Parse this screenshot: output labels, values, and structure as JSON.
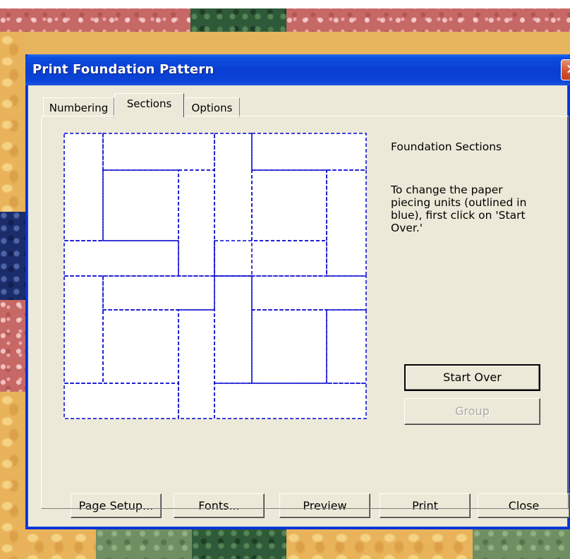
{
  "window": {
    "title": "Print Foundation Pattern",
    "close_glyph": "✕"
  },
  "tabs": [
    {
      "label": "Numbering",
      "active": false
    },
    {
      "label": "Sections",
      "active": true
    },
    {
      "label": "Options",
      "active": false
    }
  ],
  "sections_panel": {
    "heading": "Foundation Sections",
    "instructions": "To change the paper piecing units (outlined in blue), first click on 'Start Over.'",
    "start_over_label": "Start Over",
    "group_label": "Group",
    "group_enabled": false,
    "outline_color": "#0000cc"
  },
  "footer_buttons": {
    "page_setup": "Page Setup...",
    "fonts": "Fonts...",
    "preview": "Preview",
    "print": "Print",
    "close": "Close"
  },
  "colors": {
    "titlebar": "#0a3fd0",
    "dialog_face": "#ece9d8",
    "close_button": "#d5542f"
  }
}
